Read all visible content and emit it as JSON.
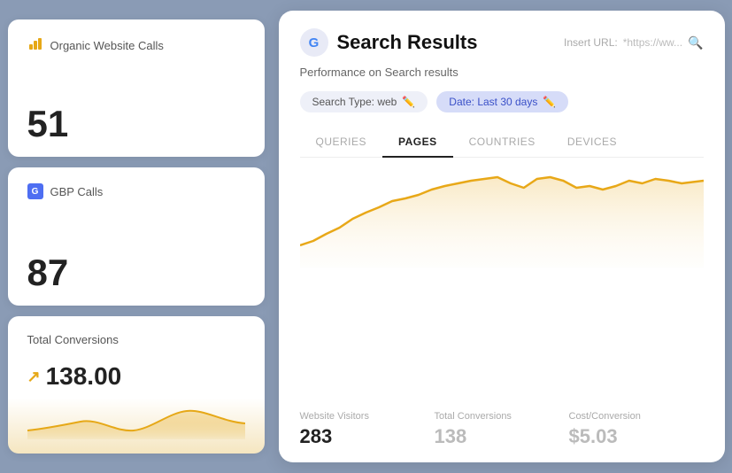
{
  "background_color": "#8a9bb5",
  "left_panel": {
    "cards": [
      {
        "id": "organic-website-calls",
        "icon": "📊",
        "title": "Organic Website Calls",
        "value": "51",
        "type": "simple"
      },
      {
        "id": "gbp-calls",
        "icon": "GBP",
        "title": "GBP Calls",
        "value": "87",
        "type": "simple"
      },
      {
        "id": "total-conversions",
        "icon": "↗",
        "title": "Total Conversions",
        "value": "138.00",
        "type": "sparkline"
      }
    ]
  },
  "right_panel": {
    "google_icon": "G",
    "title": "Search Results",
    "insert_url_label": "Insert URL:",
    "insert_url_placeholder": "*https://ww...",
    "performance_label": "Performance on Search results",
    "filters": [
      {
        "id": "search-type",
        "label": "Search Type: web",
        "editable": true
      },
      {
        "id": "date-range",
        "label": "Date: Last 30 days",
        "editable": true,
        "accent": true
      }
    ],
    "tabs": [
      {
        "id": "queries",
        "label": "QUERIES",
        "active": false
      },
      {
        "id": "pages",
        "label": "PAGES",
        "active": true
      },
      {
        "id": "countries",
        "label": "COUNTRIES",
        "active": false
      },
      {
        "id": "devices",
        "label": "DEVICES",
        "active": false
      }
    ],
    "chart": {
      "color": "#e8a818",
      "fill_color": "#f5e6c0",
      "points": [
        0.85,
        0.72,
        0.6,
        0.55,
        0.5,
        0.42,
        0.35,
        0.28,
        0.3,
        0.25,
        0.22,
        0.2,
        0.18,
        0.25,
        0.3,
        0.28,
        0.35,
        0.3,
        0.22,
        0.18,
        0.2,
        0.15,
        0.12,
        0.18,
        0.22,
        0.2,
        0.25,
        0.3,
        0.28,
        0.35
      ]
    },
    "metrics": [
      {
        "id": "website-visitors",
        "label": "Website Visitors",
        "value": "283",
        "muted": false
      },
      {
        "id": "total-conversions",
        "label": "Total Conversions",
        "value": "138",
        "muted": true
      },
      {
        "id": "cost-per-conversion",
        "label": "Cost/Conversion",
        "value": "$5.03",
        "muted": true
      }
    ]
  }
}
